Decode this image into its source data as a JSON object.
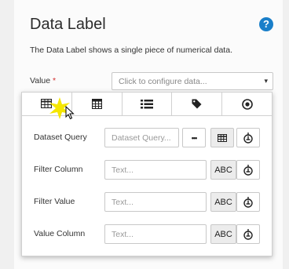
{
  "header": {
    "title": "Data Label",
    "description": "The Data Label shows a single piece of numerical data."
  },
  "value_field": {
    "label": "Value",
    "required_mark": "*",
    "placeholder": "Click to configure data...",
    "chevron": "▾"
  },
  "tabs": [
    {
      "icon": "table-icon",
      "active": true
    },
    {
      "icon": "calculator-icon",
      "active": false
    },
    {
      "icon": "list-icon",
      "active": false
    },
    {
      "icon": "tag-icon",
      "active": false
    },
    {
      "icon": "target-icon",
      "active": false
    }
  ],
  "rows": [
    {
      "label": "Dataset Query",
      "placeholder": "Dataset Query...",
      "more_label": "•••"
    },
    {
      "label": "Filter Column",
      "placeholder": "Text...",
      "type_label": "ABC"
    },
    {
      "label": "Filter Value",
      "placeholder": "Text...",
      "type_label": "ABC"
    },
    {
      "label": "Value Column",
      "placeholder": "Text...",
      "type_label": "ABC"
    }
  ],
  "colors": {
    "help_icon": "#1a7fc9",
    "required": "#d32f2f",
    "highlight": "#f5e600"
  }
}
